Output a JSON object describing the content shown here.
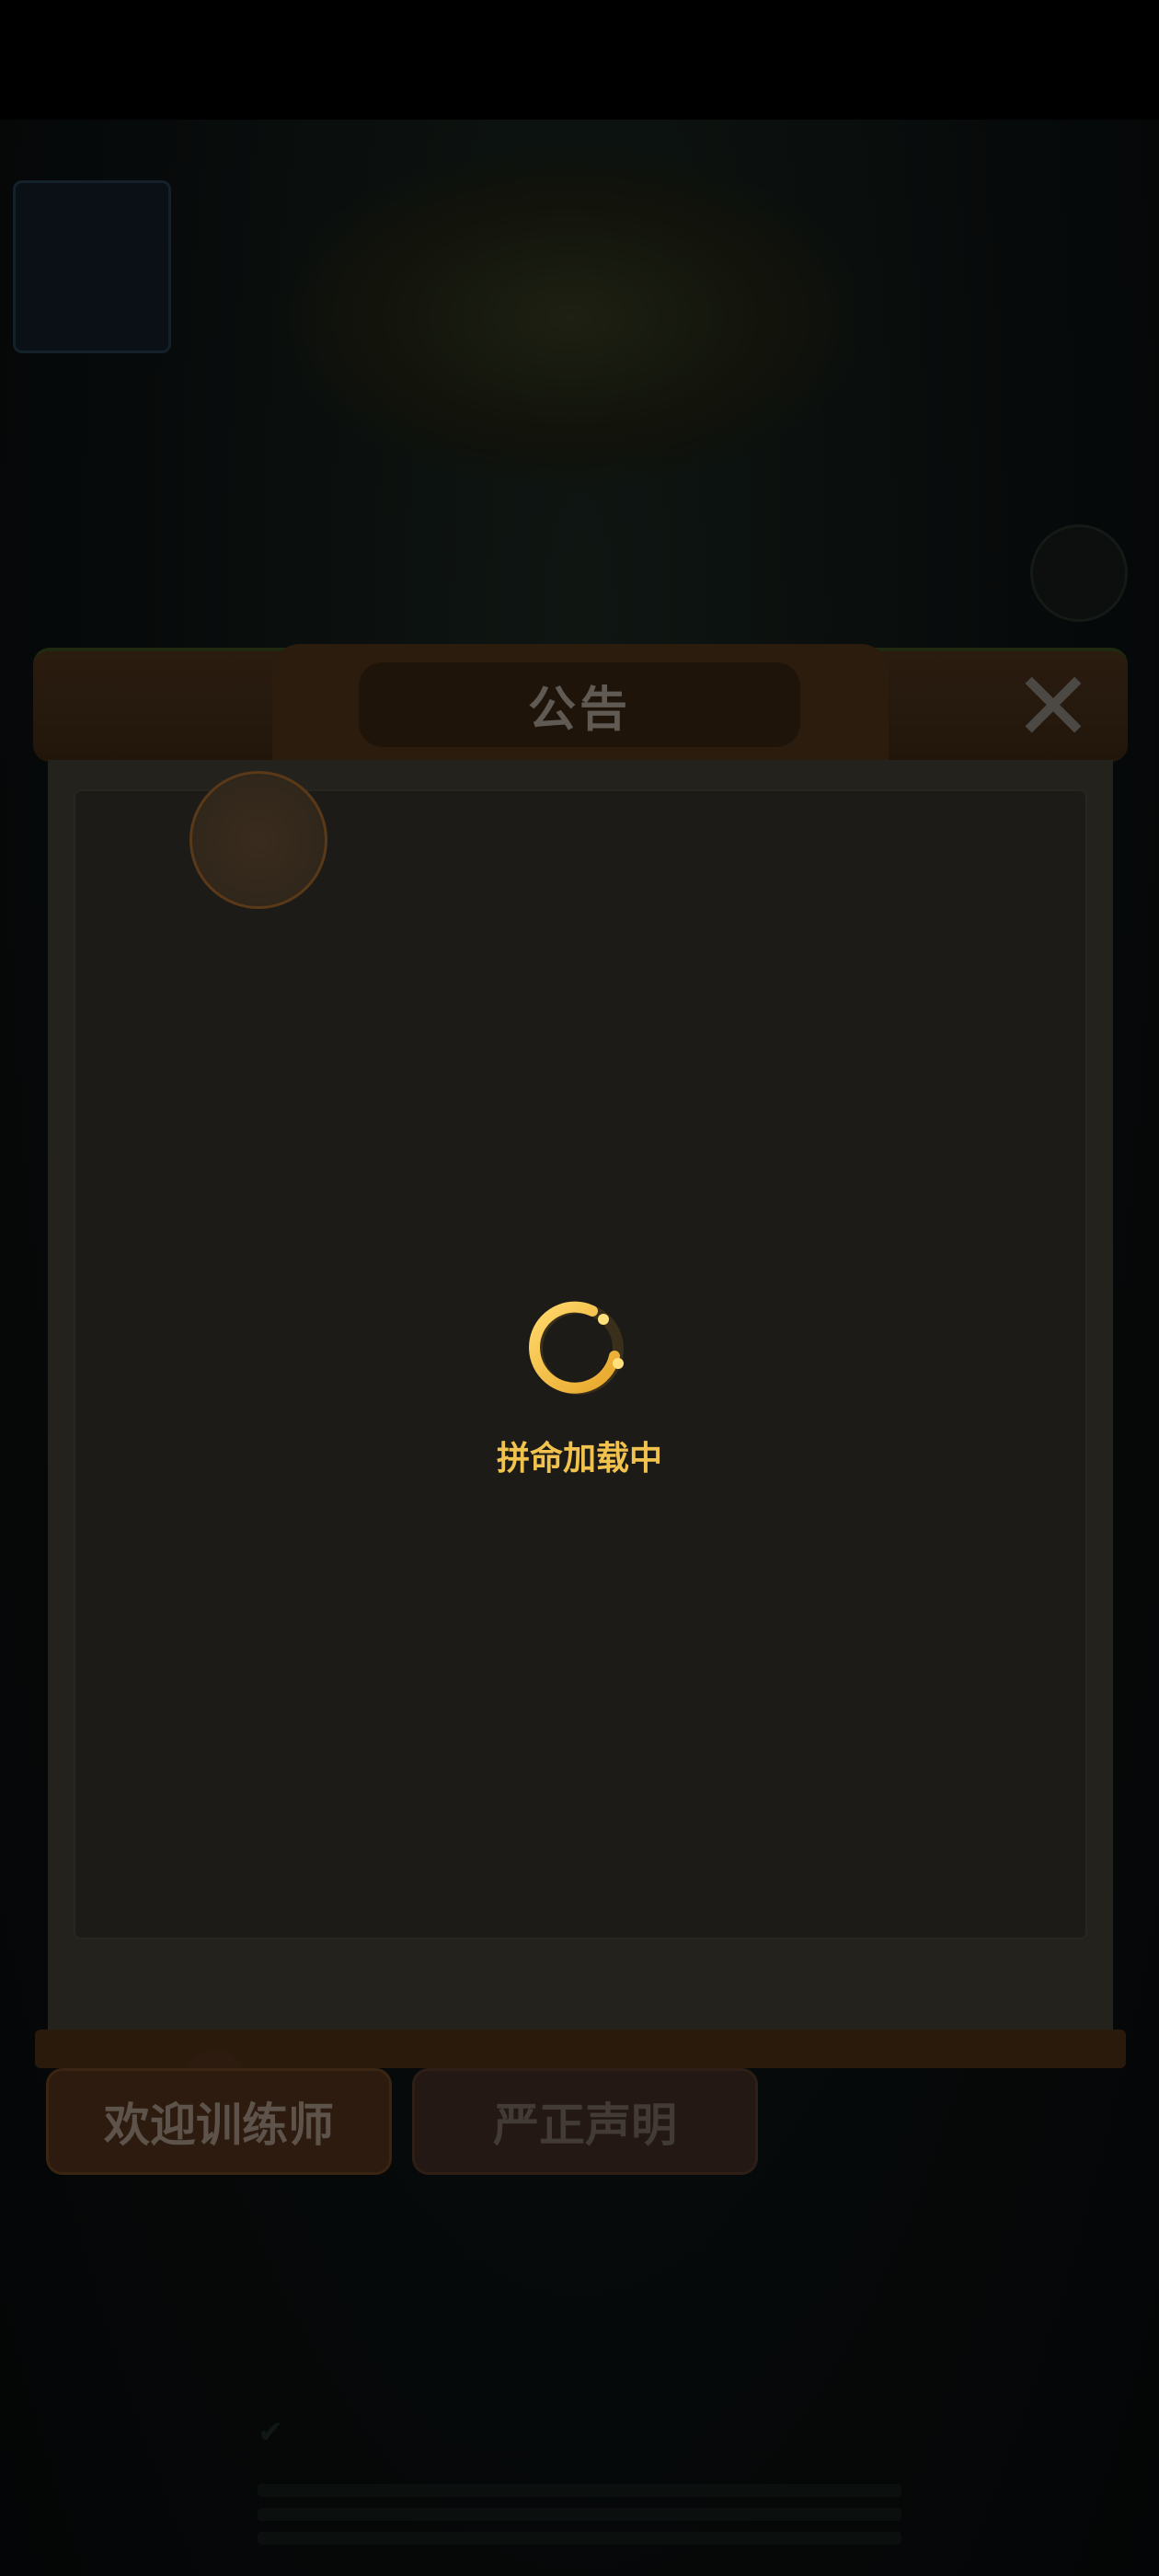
{
  "modal": {
    "title": "公告",
    "close_icon": "close-icon",
    "loading_text": "拼命加载中",
    "spinner_icon": "loading-spinner-icon"
  },
  "tabs": [
    {
      "label": "欢迎训练师",
      "active": true
    },
    {
      "label": "严正声明",
      "active": false
    }
  ],
  "colors": {
    "accent": "#f2c24e",
    "header_brown": "#2a1c0f",
    "panel": "#24221d"
  }
}
